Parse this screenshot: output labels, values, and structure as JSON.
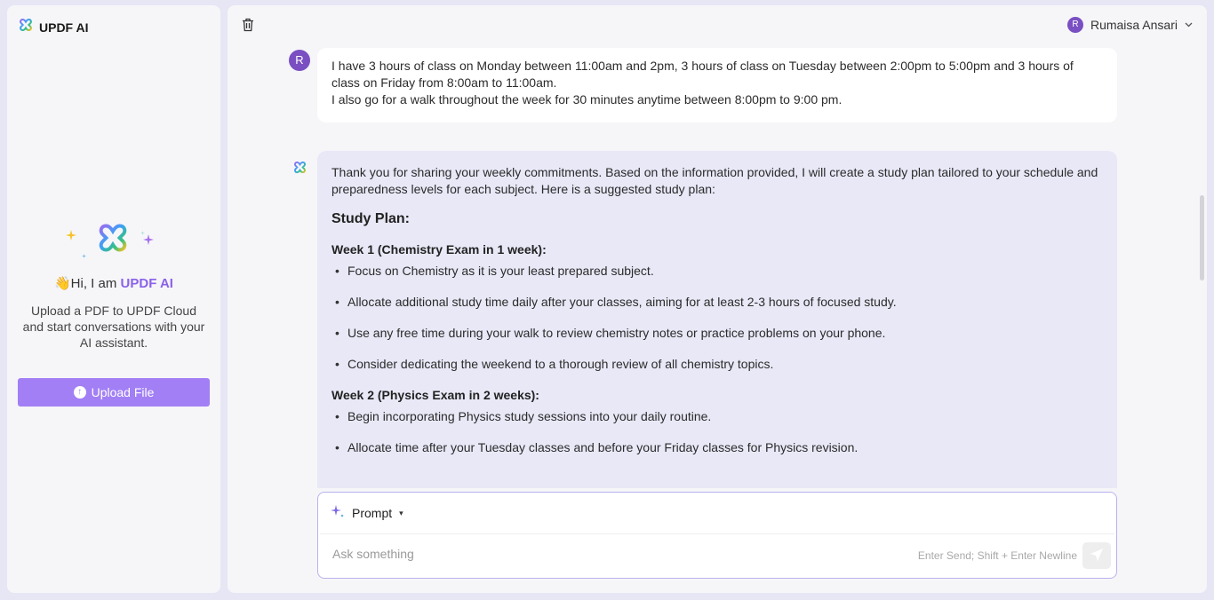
{
  "app": {
    "name": "UPDF AI"
  },
  "sidebar": {
    "greeting_prefix": "👋Hi, I am ",
    "greeting_accent": "UPDF AI",
    "description": "Upload a PDF to UPDF Cloud and start conversations with your AI assistant.",
    "upload_label": "Upload File",
    "upload_icon": "↑"
  },
  "header": {
    "user_initial": "R",
    "user_name": "Rumaisa Ansari",
    "chevron": "⌄"
  },
  "conversation": {
    "user_message": {
      "avatar_initial": "R",
      "lines": [
        "I have 3 hours of class on Monday between 11:00am and 2pm, 3 hours of class on Tuesday between 2:00pm to 5:00pm and 3 hours of class on Friday from 8:00am to 11:00am.",
        "I also go for a walk throughout the week for 30 minutes anytime between 8:00pm to 9:00 pm."
      ]
    },
    "ai_message": {
      "intro": "Thank you for sharing your weekly commitments. Based on the information provided, I will create a study plan tailored to your schedule and preparedness levels for each subject. Here is a suggested study plan:",
      "heading": "Study Plan:",
      "weeks": [
        {
          "title": "Week 1 (Chemistry Exam in 1 week):",
          "items": [
            "Focus on Chemistry as it is your least prepared subject.",
            "Allocate additional study time daily after your classes, aiming for at least 2-3 hours of focused study.",
            "Use any free time during your walk to review chemistry notes or practice problems on your phone.",
            "Consider dedicating the weekend to a thorough review of all chemistry topics."
          ]
        },
        {
          "title": "Week 2 (Physics Exam in 2 weeks):",
          "items": [
            "Begin incorporating Physics study sessions into your daily routine.",
            "Allocate time after your Tuesday classes and before your Friday classes for Physics revision."
          ]
        }
      ]
    }
  },
  "composer": {
    "mode_label": "Prompt",
    "mode_caret": "▾",
    "placeholder": "Ask something",
    "value": "",
    "hint": "Enter Send; Shift + Enter Newline"
  },
  "colors": {
    "accent": "#a27ff5",
    "avatar": "#7a4fc2",
    "ai_bubble": "#e8e8f7"
  }
}
